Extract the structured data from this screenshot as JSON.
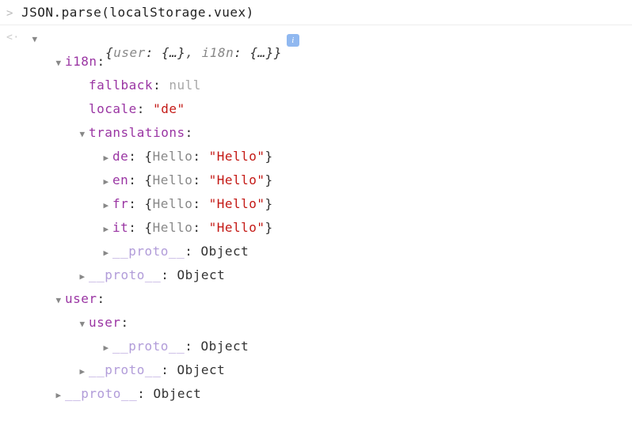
{
  "input": {
    "prompt": ">",
    "code": "JSON.parse(localStorage.vuex)"
  },
  "output": {
    "prompt": "<·",
    "summary_open": "{",
    "summary_k1": "user",
    "summary_v1": "{…}",
    "summary_sep": ", ",
    "summary_k2": "i18n",
    "summary_v2": "{…}",
    "summary_close": "}",
    "info": "i"
  },
  "tree": {
    "i18n_key": "i18n",
    "fallback_key": "fallback",
    "fallback_val": "null",
    "locale_key": "locale",
    "locale_val": "\"de\"",
    "translations_key": "translations",
    "de_key": "de",
    "de_inline_open": "{",
    "de_inline_k": "Hello",
    "de_inline_v": "\"Hello\"",
    "de_inline_close": "}",
    "en_key": "en",
    "en_inline_v": "\"Hello\"",
    "fr_key": "fr",
    "fr_inline_v": "\"Hello\"",
    "it_key": "it",
    "it_inline_v": "\"Hello\"",
    "proto_key": "__proto__",
    "proto_val": "Object",
    "user_key": "user"
  }
}
